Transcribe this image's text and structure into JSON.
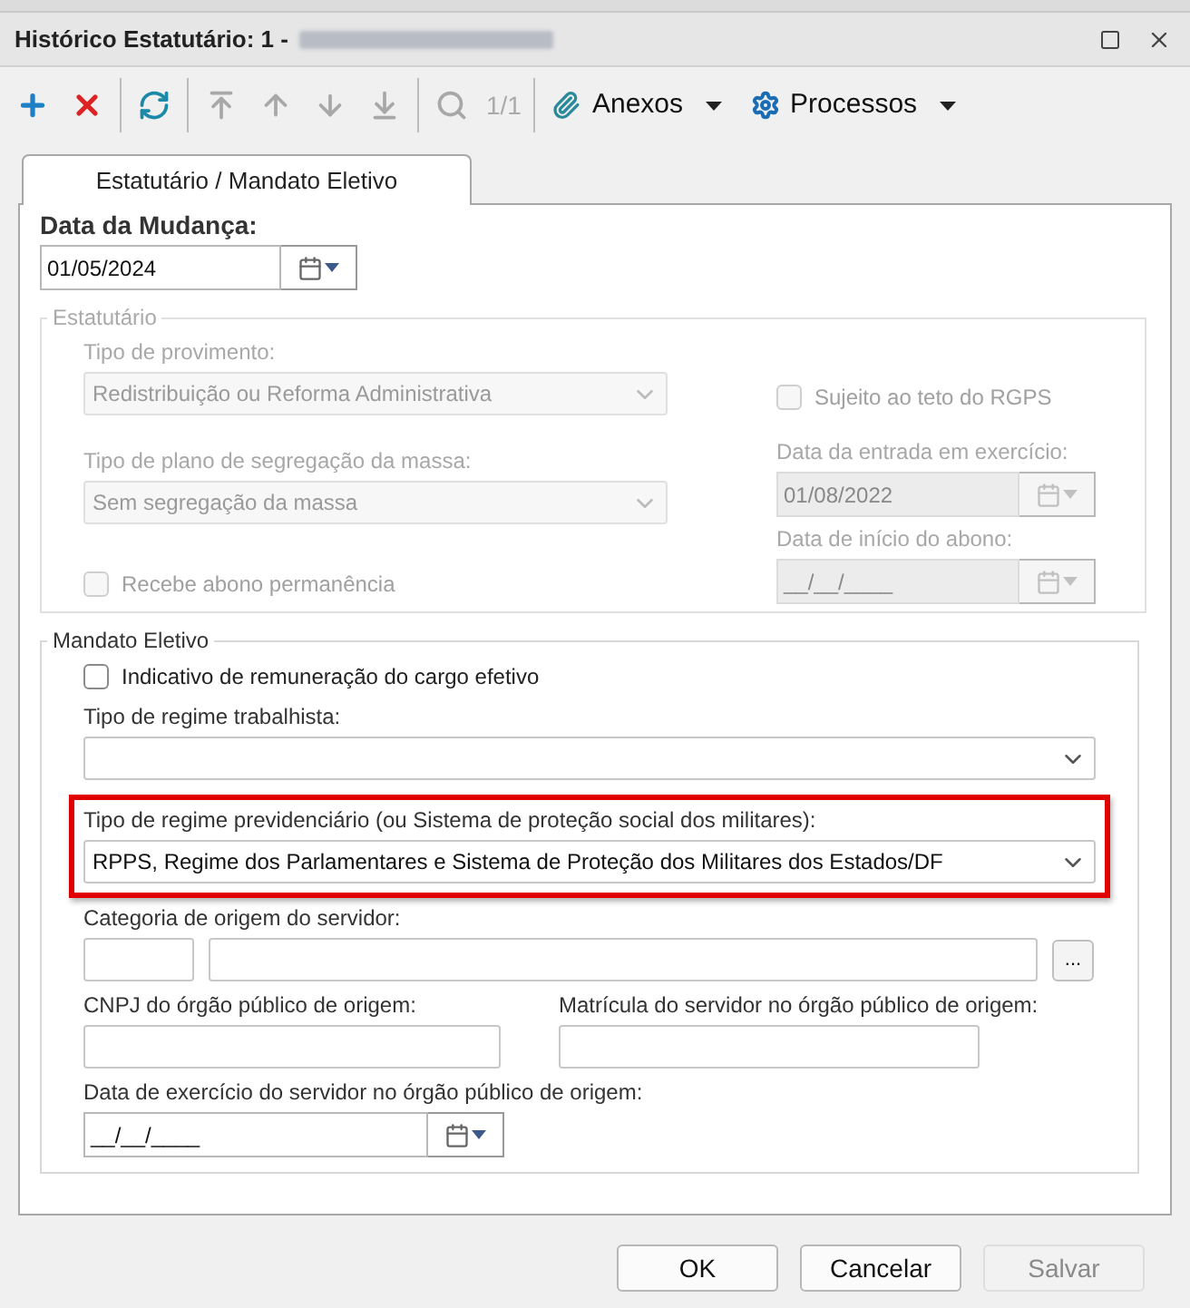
{
  "window": {
    "title": "Histórico Estatutário: 1 -",
    "redacted": true,
    "controls": [
      {
        "kind": "maximize"
      },
      {
        "kind": "close"
      }
    ]
  },
  "toolbar": [
    {
      "kind": "icon",
      "disabled": false
    },
    {
      "kind": "icon",
      "disabled": false
    },
    {
      "kind": "separator"
    },
    {
      "kind": "icon",
      "disabled": false
    },
    {
      "kind": "separator"
    },
    {
      "kind": "icon",
      "disabled": true
    },
    {
      "kind": "icon",
      "disabled": true
    },
    {
      "kind": "icon",
      "disabled": true
    },
    {
      "kind": "icon",
      "disabled": true
    },
    {
      "kind": "separator"
    },
    {
      "kind": "icon",
      "disabled": true
    },
    {
      "kind": "counter",
      "text": "1/1",
      "disabled": true
    },
    {
      "kind": "separator"
    },
    {
      "kind": "menu",
      "label": "Anexos"
    },
    {
      "kind": "menu",
      "label": "Processos"
    }
  ],
  "tabs": [
    {
      "label": "Estatutário / Mandato Eletivo",
      "selected": true
    }
  ],
  "change_date": {
    "label": "Data da Mudança:",
    "value": "01/05/2024"
  },
  "estatutario": {
    "title": "Estatutário",
    "disabled": true,
    "tipo_provimento": {
      "label": "Tipo de provimento:",
      "value": "Redistribuição ou Reforma Administrativa"
    },
    "sujeito_teto": {
      "label": "Sujeito ao teto do RGPS",
      "checked": false
    },
    "tipo_plano": {
      "label": "Tipo de plano de segregação da massa:",
      "value": "Sem segregação da massa"
    },
    "data_entrada": {
      "label": "Data da entrada em exercício:",
      "value": "01/08/2022"
    },
    "data_abono": {
      "label": "Data de início do abono:",
      "value": "__/__/____"
    },
    "recebe_abono": {
      "label": "Recebe abono permanência",
      "checked": false
    }
  },
  "mandato": {
    "title": "Mandato Eletivo",
    "indicativo": {
      "label": "Indicativo de remuneração do cargo efetivo",
      "checked": false
    },
    "regime_trabalhista": {
      "label": "Tipo de regime trabalhista:"
    },
    "regime_previdenciario": {
      "label": "Tipo de regime previdenciário (ou Sistema de proteção social dos militares):",
      "value": "RPPS, Regime dos Parlamentares e Sistema de Proteção dos Militares dos Estados/DF",
      "highlighted": true
    },
    "categoria": {
      "label": "Categoria de origem do servidor:",
      "button": "..."
    },
    "cnpj": {
      "label": "CNPJ do órgão público de origem:"
    },
    "matricula": {
      "label": "Matrícula do servidor no órgão público de origem:"
    },
    "data_exercicio": {
      "label": "Data de exercício do servidor no órgão público de origem:",
      "value": "__/__/____"
    }
  },
  "buttons": [
    {
      "label": "OK",
      "disabled": false
    },
    {
      "label": "Cancelar",
      "disabled": false
    },
    {
      "label": "Salvar",
      "disabled": true
    }
  ]
}
